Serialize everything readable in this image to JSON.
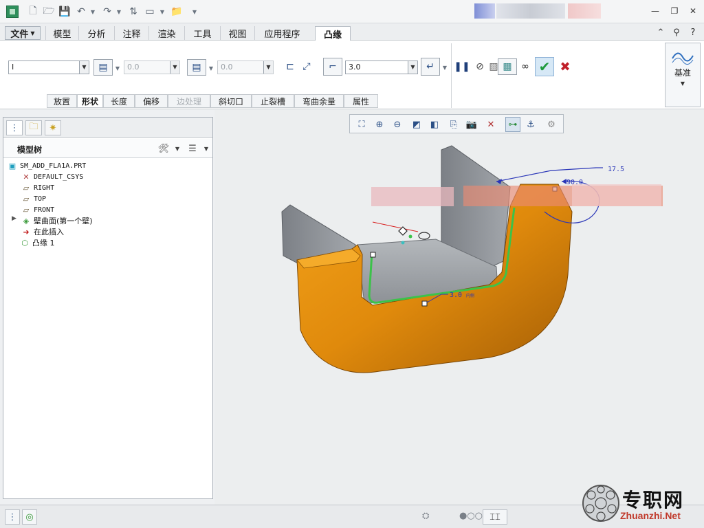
{
  "quick_access": {
    "icons": [
      "app-icon",
      "new-file-icon",
      "open-folder-icon",
      "save-icon",
      "undo-icon",
      "redo-icon",
      "regenerate-icon",
      "window-icon",
      "folder-icon",
      "customize-icon"
    ]
  },
  "window_controls": {
    "minimize": "—",
    "restore": "❐",
    "close": "✕"
  },
  "tabs": {
    "file": "文件",
    "items": [
      "模型",
      "分析",
      "注释",
      "渲染",
      "工具",
      "视图",
      "应用程序",
      "凸缘"
    ],
    "active": "凸缘"
  },
  "ribbon": {
    "shape_select": "I",
    "length1_value": "0.0",
    "length2_value": "0.0",
    "thickness_value": "3.0",
    "subtabs": [
      "放置",
      "形状",
      "长度",
      "偏移",
      "边处理",
      "斜切口",
      "止裂槽",
      "弯曲余量",
      "属性"
    ],
    "disabled_subtab": "边处理",
    "datum_label": "基准"
  },
  "model_tree": {
    "title": "模型树",
    "items": [
      {
        "label": "SM_ADD_FLA1A.PRT",
        "icon": "part-icon"
      },
      {
        "label": "DEFAULT_CSYS",
        "icon": "csys-icon"
      },
      {
        "label": "RIGHT",
        "icon": "plane-icon"
      },
      {
        "label": "TOP",
        "icon": "plane-icon"
      },
      {
        "label": "FRONT",
        "icon": "plane-icon"
      },
      {
        "label": "壁曲面(第一个壁)",
        "icon": "wall-icon"
      },
      {
        "label": "在此插入",
        "icon": "insert-here-icon"
      },
      {
        "label": "凸缘 1",
        "icon": "flange-icon"
      }
    ]
  },
  "viewport": {
    "dim_17_5": "17.5",
    "dim_90": "90.0",
    "dim_3_0": "3.0",
    "dim_3_0_suffix": "内侧",
    "colors": {
      "model_orange": "#e8920f",
      "model_gray": "#8e9297",
      "sketch_green": "#3cc24a",
      "dim_blue": "#2a36b8"
    }
  },
  "watermark": {
    "cn": "专职网",
    "url": "Zhuanzhi.Net"
  }
}
